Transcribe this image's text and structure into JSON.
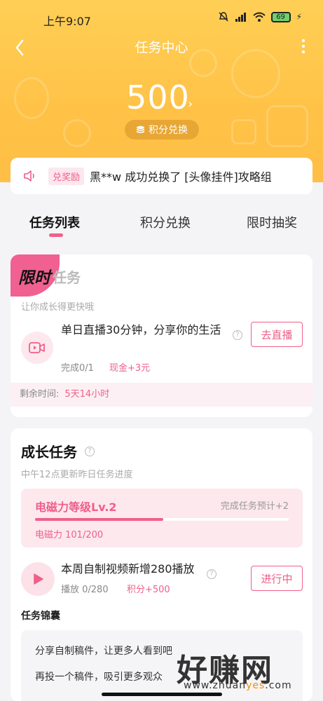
{
  "status_bar": {
    "time": "上午9:07",
    "battery": "69"
  },
  "nav": {
    "title": "任务中心"
  },
  "points": {
    "value": "500",
    "exchange_label": "积分兑换"
  },
  "notice": {
    "tag": "兑奖励",
    "text": "黑**w 成功兑换了 [头像挂件]攻略组"
  },
  "tabs": [
    {
      "label": "任务列表",
      "active": true
    },
    {
      "label": "积分兑换",
      "active": false
    },
    {
      "label": "限时抽奖",
      "active": false
    }
  ],
  "limited_card": {
    "badge": "限时",
    "title": "任务",
    "subtitle": "让你成长得更快哦",
    "task": {
      "title": "单日直播30分钟，分享你的生活",
      "progress": "完成0/1",
      "reward": "现金+3元",
      "button": "去直播"
    },
    "remaining_label": "剩余时间:",
    "remaining_value": "5天14小时"
  },
  "growth_card": {
    "title": "成长任务",
    "subtitle": "中午12点更新昨日任务进度",
    "level": {
      "name": "电磁力等级Lv.2",
      "hint": "完成任务预计+2",
      "progress_text": "电磁力 101/200",
      "progress_fraction": 0.505
    },
    "task": {
      "title": "本周自制视频新增280播放",
      "progress": "播放 0/280",
      "reward": "积分+500",
      "button": "进行中"
    },
    "tips_title": "任务锦囊",
    "tips": [
      "分享自制稿件，让更多人看到吧",
      "再投一个稿件，吸引更多观众"
    ]
  },
  "watermark": {
    "main": "好赚网",
    "sub_prefix": "www.zhuan",
    "sub_highlight": "yes",
    "sub_suffix": ".com"
  },
  "colors": {
    "accent": "#ef5f8a",
    "header": "#ffc247"
  }
}
